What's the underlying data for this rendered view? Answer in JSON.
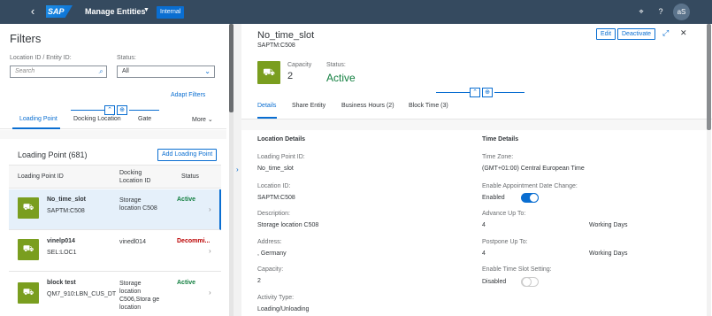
{
  "shell": {
    "logo": "SAP",
    "app_title": "Manage Entities",
    "env_badge": "Internal",
    "avatar": "aS",
    "icons": [
      "back-icon",
      "pin-icon",
      "help-icon"
    ]
  },
  "filters": {
    "title": "Filters",
    "location_label": "Location ID / Entity ID:",
    "search_placeholder": "Search",
    "status_label": "Status:",
    "status_value": "All",
    "adapt_filters": "Adapt Filters",
    "tabs": [
      "Loading Point",
      "Docking Location",
      "Gate"
    ],
    "more": "More"
  },
  "list": {
    "title": "Loading Point (681)",
    "add_button": "Add Loading Point",
    "headers": {
      "id": "Loading Point ID",
      "docking": "Docking Location ID",
      "status": "Status"
    },
    "rows": [
      {
        "name": "No_time_slot",
        "sub": "SAPTM:C508",
        "docking": "Storage location C508",
        "status": "Active",
        "status_type": "active"
      },
      {
        "name": "vinelp014",
        "sub": "SEL:LOC1",
        "docking": "vinedl014",
        "status": "Decommi...",
        "status_type": "error"
      },
      {
        "name": "block test",
        "sub": "QM7_910:LBN_CUS_DT",
        "docking": "Storage location C506,Stora ge location",
        "status": "Active",
        "status_type": "active"
      }
    ]
  },
  "detail": {
    "title": "No_time_slot",
    "subtitle": "SAPTM:C508",
    "buttons": {
      "edit": "Edit",
      "deactivate": "Deactivate"
    },
    "capacity_label": "Capacity",
    "capacity_value": "2",
    "status_label": "Status:",
    "status_value": "Active",
    "tabs": [
      "Details",
      "Share Entity",
      "Business Hours (2)",
      "Block Time (3)"
    ],
    "location_section": "Location Details",
    "time_section": "Time Details",
    "location_fields": [
      {
        "label": "Loading Point ID:",
        "value": "No_time_slot"
      },
      {
        "label": "Location ID:",
        "value": "SAPTM:C508"
      },
      {
        "label": "Description:",
        "value": "Storage location C508"
      },
      {
        "label": "Address:",
        "value": ", Germany"
      },
      {
        "label": "Capacity:",
        "value": "2"
      },
      {
        "label": "Activity Type:",
        "value": "Loading/Unloading"
      }
    ],
    "time_fields": {
      "time_zone_label": "Time Zone:",
      "time_zone_value": "(GMT+01:00) Central European Time",
      "appt_change_label": "Enable Appointment Date Change:",
      "appt_change_value": "Enabled",
      "advance_label": "Advance Up To:",
      "advance_value": "4",
      "advance_unit": "Working Days",
      "postpone_label": "Postpone Up To:",
      "postpone_value": "4",
      "postpone_unit": "Working Days",
      "timeslot_label": "Enable Time Slot Setting:",
      "timeslot_value": "Disabled"
    }
  }
}
